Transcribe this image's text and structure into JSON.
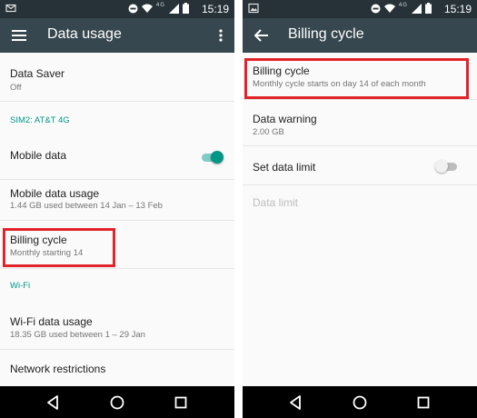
{
  "status_bar": {
    "left_icons": [
      "mail-icon",
      "image-icon"
    ],
    "network_label": "4G",
    "time": "15:19"
  },
  "left_screen": {
    "title": "Data usage",
    "items": {
      "data_saver": {
        "title": "Data Saver",
        "summary": "Off"
      },
      "sim_header": "SIM2: AT&T 4G",
      "mobile_data": {
        "title": "Mobile data",
        "toggle_on": true
      },
      "mobile_data_usage": {
        "title": "Mobile data usage",
        "summary": "1.44 GB used between 14 Jan – 13 Feb"
      },
      "billing_cycle": {
        "title": "Billing cycle",
        "summary": "Monthly starting 14"
      },
      "wifi_header": "Wi-Fi",
      "wifi_data_usage": {
        "title": "Wi-Fi data usage",
        "summary": "18.35 GB used between 1 – 29 Jan"
      },
      "network_restrictions": {
        "title": "Network restrictions"
      }
    }
  },
  "right_screen": {
    "title": "Billing cycle",
    "items": {
      "billing_cycle": {
        "title": "Billing cycle",
        "summary": "Monthly cycle starts on day 14 of each month"
      },
      "data_warning": {
        "title": "Data warning",
        "summary": "2.00 GB"
      },
      "set_data_limit": {
        "title": "Set data limit",
        "toggle_on": false
      },
      "data_limit": {
        "title": "Data limit",
        "enabled": false
      }
    }
  },
  "colors": {
    "status_bar": "#263238",
    "app_bar": "#37474f",
    "accent": "#009688",
    "highlight": "#e2232a",
    "nav_bar": "#000000"
  },
  "icons": {
    "nav_back": "triangle-back-icon",
    "nav_home": "circle-home-icon",
    "nav_recents": "square-recents-icon"
  }
}
